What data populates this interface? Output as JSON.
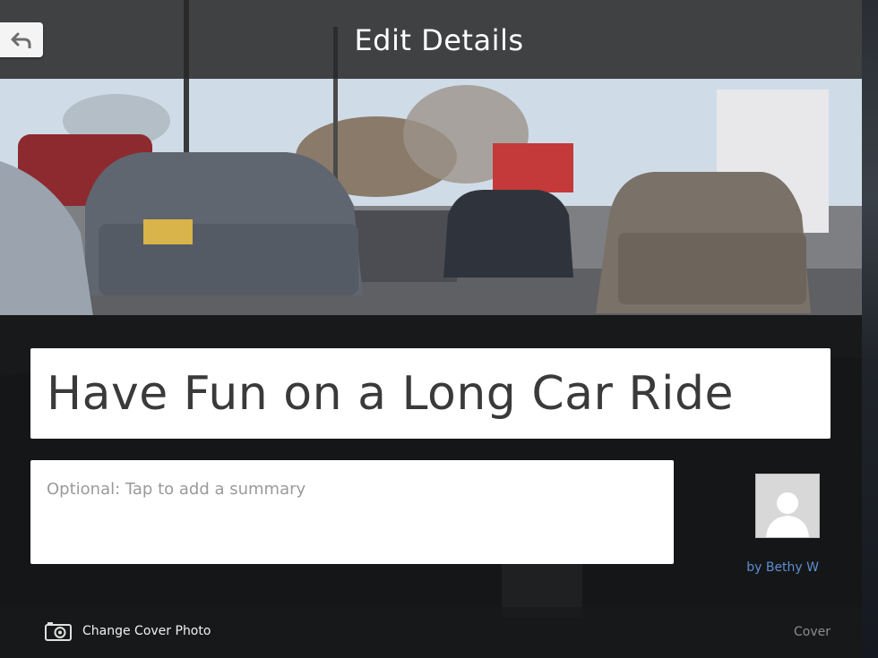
{
  "header": {
    "title": "Edit Details",
    "back_icon": "undo-arrow-icon"
  },
  "form": {
    "title_value": "Have Fun on a Long Car Ride",
    "summary_placeholder": "Optional: Tap to add a summary"
  },
  "author": {
    "byline": "by Bethy W",
    "avatar_icon": "default-user-avatar-icon"
  },
  "bottom_bar": {
    "change_cover_label": "Change Cover Photo",
    "camera_icon": "camera-icon",
    "cover_label": "Cover"
  },
  "colors": {
    "header_bg": "#282828",
    "byline": "#5b8fd0",
    "field_bg": "#ffffff"
  }
}
